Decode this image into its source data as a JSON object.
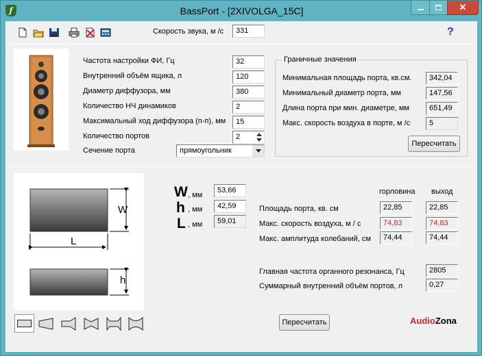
{
  "window": {
    "title": "BassPort - [2XIVOLGA_15C]",
    "app_icon": "bass-speaker-app-icon",
    "close_glyph": "✕"
  },
  "toolbar": {
    "sound_speed_label": "Скорость звука, м /с",
    "sound_speed_value": "331",
    "help": "?"
  },
  "params": {
    "tuning_freq_label": "Частота настройки ФИ, Гц",
    "tuning_freq_value": "32",
    "box_volume_label": "Внутренний объём ящика, л",
    "box_volume_value": "120",
    "diameter_label": "Диаметр диффузора, мм",
    "diameter_value": "380",
    "drivers_label": "Количество НЧ динамиков",
    "drivers_value": "2",
    "xmax_label": "Максимальный ход диффузора (п-п), мм",
    "xmax_value": "15",
    "ports_label": "Количество портов",
    "ports_value": "2",
    "section_label": "Сечение порта",
    "section_value": "прямоугольник"
  },
  "limits": {
    "title": "Граничные значения",
    "min_area_label": "Минимальная площадь порта, кв.см.",
    "min_area_value": "342,04",
    "min_diam_label": "Минимальный диаметр порта, мм",
    "min_diam_value": "147,56",
    "len_label": "Длина порта при мин. диаметре, мм",
    "len_value": "651,49",
    "max_speed_label": "Макс. скорость воздуха в порте, м /с",
    "max_speed_value": "5",
    "recalc": "Пересчитать"
  },
  "port": {
    "w_letter": "W",
    "w_unit": ", мм",
    "w_value": "53,66",
    "h_letter": "h",
    "h_unit": ", мм",
    "h_value": "42,59",
    "l_letter": "L",
    "l_unit": ", мм",
    "l_value": "59,01",
    "diagram_w": "W",
    "diagram_l": "L",
    "diagram_h": "h"
  },
  "results": {
    "col_throat": "горловина",
    "col_exit": "выход",
    "area_label": "Площадь порта, кв. см",
    "area_throat": "22,85",
    "area_exit": "22,85",
    "speed_label": "Макс. скорость воздуха, м / с",
    "speed_throat": "74,83",
    "speed_exit": "74,83",
    "ampl_label": "Макс. амплитуда колебаний, см",
    "ampl_throat": "74,44",
    "ampl_exit": "74,44",
    "organ_label": "Главная частота органного резонанса, Гц",
    "organ_value": "2805",
    "total_vol_label": "Суммарный внутренний объём портов, л",
    "total_vol_value": "0,27",
    "recalc": "Пересчитать"
  },
  "brand": {
    "audio": "Audio",
    "zona": "Zona",
    "audio_color": "#c62828",
    "zona_color": "#000000"
  },
  "colors": {
    "speed_warning": "#c62828",
    "speaker_wood": "#c8803e"
  }
}
